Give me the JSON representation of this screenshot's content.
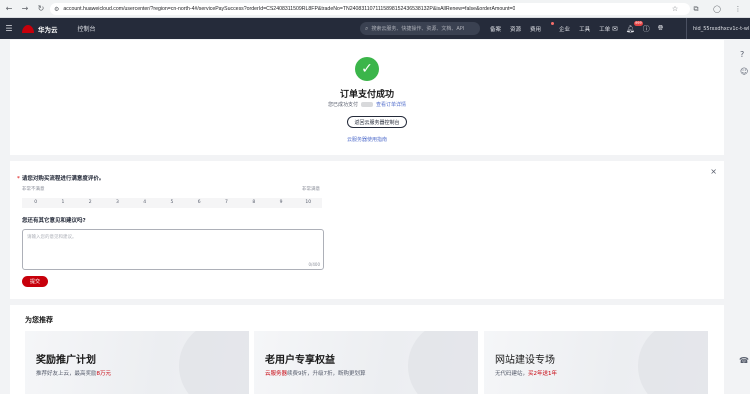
{
  "browser": {
    "url": "account.huaweicloud.com/usercenter/?region=cn-north-4#/servicePaySuccess?orderId=CS2408311509RL8FP&tradeNo=TN2408311071115898152436538132P&isAllRenew=false&orderAmount=0",
    "back_icon": "←",
    "forward_icon": "→",
    "reload_icon": "↻",
    "site_icon": "⚙"
  },
  "header": {
    "brand": "华为云",
    "console": "控制台",
    "search_placeholder": "搜索云服务、快捷操作、资源、文档、API",
    "menu": [
      "备案",
      "资源",
      "费用",
      "企业",
      "工具",
      "工单"
    ],
    "user": "hid_55rxxdhxcv1c-t-wl",
    "hot_badge": "999"
  },
  "success": {
    "title": "订单支付成功",
    "sub_prefix": "您已成功支付",
    "view_order": "查看订单详情",
    "back_button": "返回云服务器控制台",
    "guide_link": "云服务器使用指南"
  },
  "survey": {
    "question1": "请您对购买流程进行满意度评价。",
    "scale_low": "非常不满意",
    "scale_high": "非常满意",
    "scale": [
      "0",
      "1",
      "2",
      "3",
      "4",
      "5",
      "6",
      "7",
      "8",
      "9",
      "10"
    ],
    "question2": "您还有其它意见和建议吗?",
    "textarea_placeholder": "请输入您的意见和建议。",
    "counter": "0/400",
    "submit": "提交"
  },
  "recommend": {
    "title": "为您推荐",
    "items": [
      {
        "title": "奖励推广计划",
        "desc_prefix": "推荐好友上云，最高奖励",
        "desc_red": "8万元",
        "desc_suffix": ""
      },
      {
        "title": "老用户专享权益",
        "desc_prefix": "",
        "desc_red": "云服务器",
        "desc_suffix": "续费9折，升级7折，断购更划算"
      },
      {
        "title": "网站建设专场",
        "desc_prefix": "无代码建站，",
        "desc_red": "买2年送1年",
        "desc_suffix": ""
      }
    ]
  }
}
